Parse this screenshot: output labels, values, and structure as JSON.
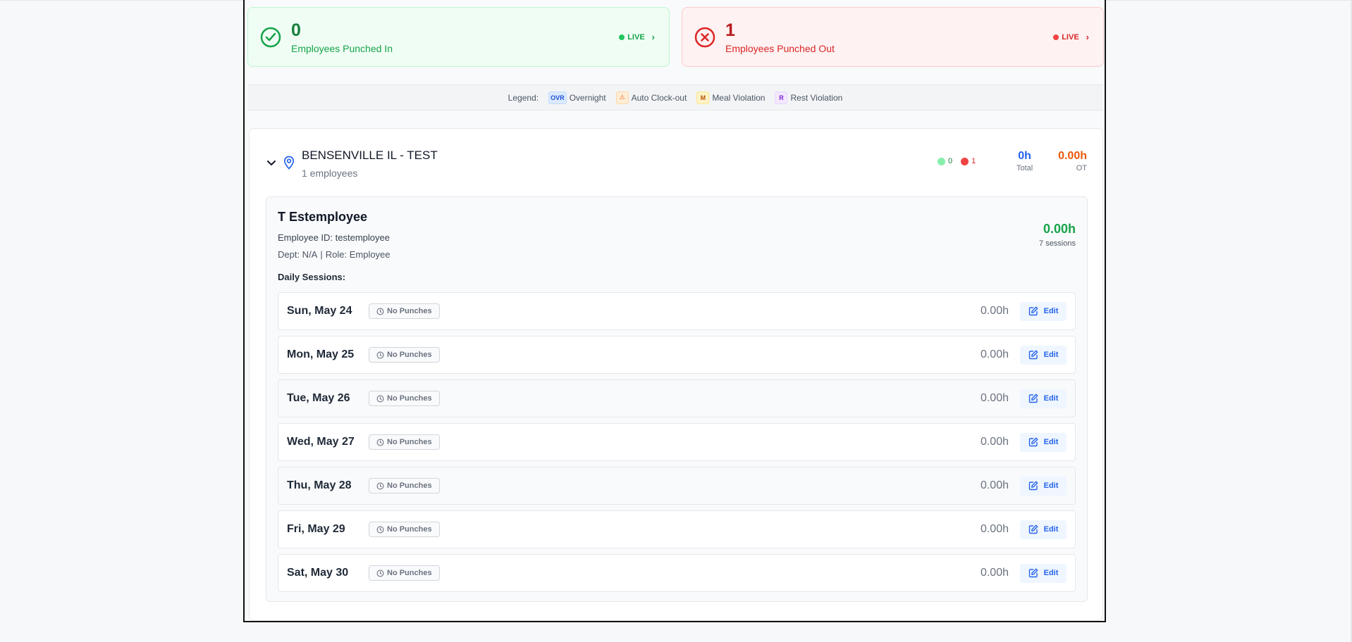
{
  "summary": {
    "punched_in": {
      "count": "0",
      "label": "Employees Punched In",
      "live": "LIVE"
    },
    "punched_out": {
      "count": "1",
      "label": "Employees Punched Out",
      "live": "LIVE"
    }
  },
  "legend": {
    "title": "Legend:",
    "items": [
      {
        "badge": "OVR",
        "label": "Overnight"
      },
      {
        "badge": "⚠",
        "label": "Auto Clock-out"
      },
      {
        "badge": "M",
        "label": "Meal Violation"
      },
      {
        "badge": "R",
        "label": "Rest Violation"
      }
    ]
  },
  "location": {
    "name": "BENSENVILLE IL - TEST",
    "employee_count": "1 employees",
    "in_count": "0",
    "out_count": "1",
    "total_value": "0h",
    "total_label": "Total",
    "ot_value": "0.00h",
    "ot_label": "OT"
  },
  "employee": {
    "name": "T Estemployee",
    "id_label": "Employee ID:",
    "id_value": "testemployee",
    "dept": "Dept: N/A",
    "separator": "|",
    "role": "Role: Employee",
    "hours": "0.00h",
    "sessions": "7 sessions",
    "daily_label": "Daily Sessions:"
  },
  "sessions": [
    {
      "date": "Sun, May 24",
      "status": "No Punches",
      "hours": "0.00h",
      "edit": "Edit"
    },
    {
      "date": "Mon, May 25",
      "status": "No Punches",
      "hours": "0.00h",
      "edit": "Edit"
    },
    {
      "date": "Tue, May 26",
      "status": "No Punches",
      "hours": "0.00h",
      "edit": "Edit"
    },
    {
      "date": "Wed, May 27",
      "status": "No Punches",
      "hours": "0.00h",
      "edit": "Edit"
    },
    {
      "date": "Thu, May 28",
      "status": "No Punches",
      "hours": "0.00h",
      "edit": "Edit"
    },
    {
      "date": "Fri, May 29",
      "status": "No Punches",
      "hours": "0.00h",
      "edit": "Edit"
    },
    {
      "date": "Sat, May 30",
      "status": "No Punches",
      "hours": "0.00h",
      "edit": "Edit"
    }
  ],
  "colors": {
    "green": "#16a34a",
    "red": "#dc2626",
    "blue": "#2563eb",
    "orange": "#ea580c"
  }
}
